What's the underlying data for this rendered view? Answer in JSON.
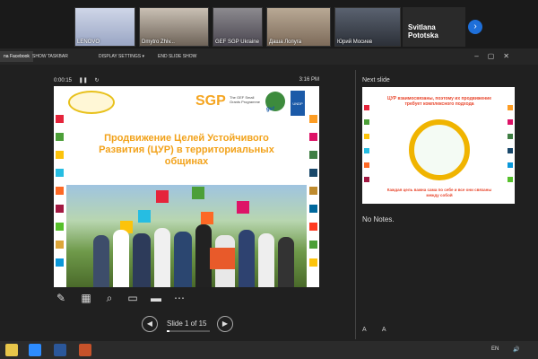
{
  "participants": [
    {
      "name": "LENOVO"
    },
    {
      "name": "Dmytro Zhiv..."
    },
    {
      "name": "GEF SGP Ukraine"
    },
    {
      "name": "Даша Лопуга"
    },
    {
      "name": "Юрий Мосиев"
    },
    {
      "name": "Svitlana Pototska"
    }
  ],
  "toolbar": {
    "facebook_tab": "na Facebook",
    "show_taskbar": "SHOW TASKBAR",
    "display_settings": "DISPLAY SETTINGS ▾",
    "end_slide_show": "END SLIDE SHOW"
  },
  "presenter": {
    "elapsed": "0:00:15",
    "clock": "3:16 PM",
    "slide_count": "Slide 1 of 15",
    "progress": 0.067
  },
  "current_slide": {
    "title": "Продвижение Целей Устойчивого Развития (ЦУР) в территориальных общинах",
    "sgp": "SGP",
    "sgp_sub": "The GEF Small Grants Programme",
    "gef": "gef",
    "undp": "UNDP"
  },
  "next_slide": {
    "label": "Next slide",
    "title": "ЦУР взаимосвязаны, поэтому их продвижение требует комплексного подхода",
    "footer": "Каждая цель важна сама по себе и все они связаны между собой"
  },
  "notes": {
    "text": "No Notes."
  },
  "font_size_controls": "A A",
  "tray": {
    "lang": "EN"
  },
  "colors": {
    "slide_title": "#f2a21a",
    "zoom_blue": "#1e6fd9",
    "next_title": "#e8462c"
  }
}
